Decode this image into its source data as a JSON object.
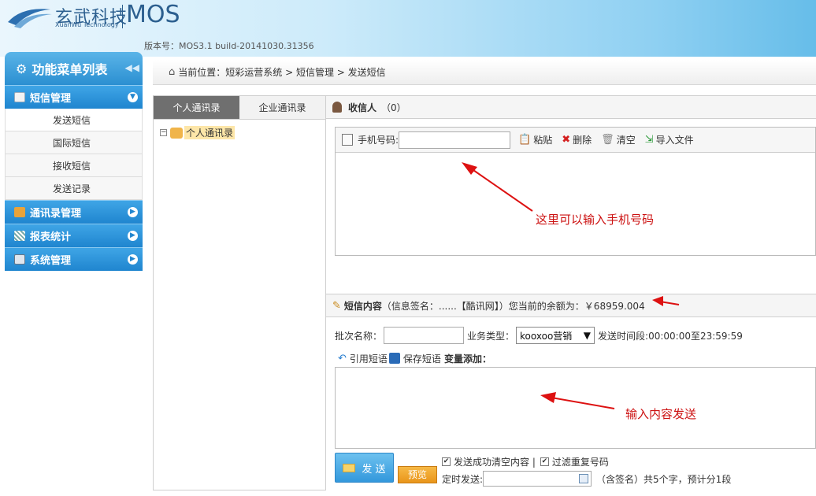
{
  "header": {
    "logo_cn": "玄武科技",
    "logo_en": "XuanWu Technology",
    "product": "MOS",
    "version": "版本号：MOS3.1 build-20141030.31356"
  },
  "sidebar": {
    "title": "功能菜单列表",
    "groups": [
      {
        "label": "短信管理",
        "expanded": true,
        "items": [
          {
            "label": "发送短信",
            "active": true
          },
          {
            "label": "国际短信"
          },
          {
            "label": "接收短信"
          },
          {
            "label": "发送记录"
          }
        ]
      },
      {
        "label": "通讯录管理"
      },
      {
        "label": "报表统计"
      },
      {
        "label": "系统管理"
      }
    ]
  },
  "breadcrumb": "当前位置：短彩运营系统 > 短信管理 > 发送短信",
  "contacts": {
    "tabs": [
      "个人通讯录",
      "企业通讯录"
    ],
    "tree_root": "个人通讯录"
  },
  "recipients": {
    "title": "收信人",
    "count": "（0）",
    "phone_label": "手机号码:",
    "phone_value": "",
    "paste": "粘贴",
    "delete": "删除",
    "clear": "清空",
    "import": "导入文件"
  },
  "content": {
    "title": "短信内容",
    "signature_info": "（信息签名：......【酷讯网】）您当前的余额为：￥68959.004",
    "batch_label": "批次名称：",
    "batch_value": "",
    "biz_label": "业务类型：",
    "biz_value": "kooxoo营销",
    "time_range": "发送时间段:00:00:00至23:59:59",
    "quote": "引用短语",
    "save": "保存短语",
    "var_add": "变量添加：",
    "message": ""
  },
  "actions": {
    "send": "发 送",
    "preview": "预览",
    "opt_clear": "发送成功清空内容 |",
    "opt_filter": "过滤重复号码",
    "timed_label": "定时发送:",
    "count_info": "（含签名）共5个字，预计分1段"
  },
  "annotations": {
    "phone_hint": "这里可以输入手机号码",
    "content_hint": "输入内容发送"
  },
  "colors": {
    "accent": "#2b8fd1",
    "annotation": "#cc1111",
    "preview_btn": "#e9951b"
  }
}
